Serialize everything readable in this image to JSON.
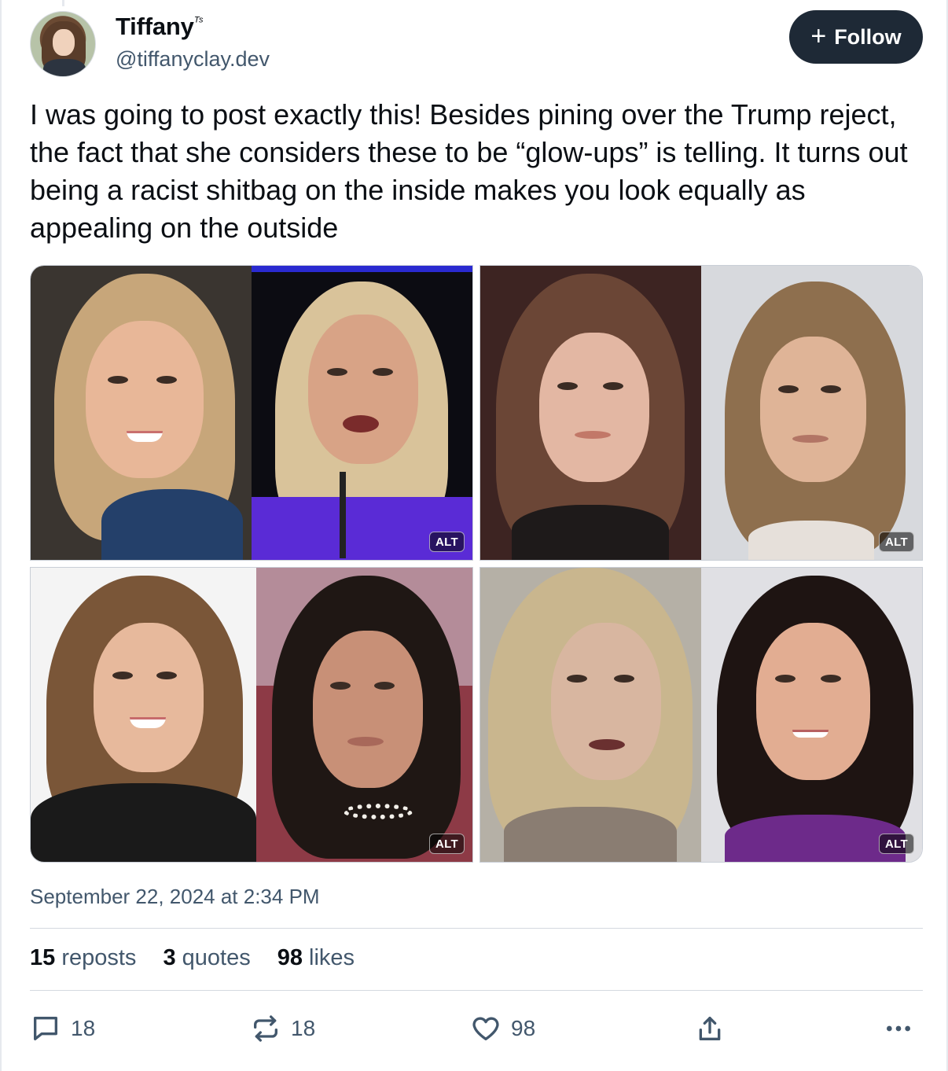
{
  "author": {
    "display_name": "Tiffany",
    "name_suffix": "ᵀˢ",
    "handle": "@tiffanyclay.dev"
  },
  "follow_button": {
    "label": "Follow",
    "icon": "plus-icon"
  },
  "post": {
    "text": "I was going to post exactly this! Besides pining over the Trump reject, the fact that she considers these to be “glow-ups” is telling. It turns out being a racist shitbag on the inside makes you look equally as appealing on the outside",
    "images": [
      {
        "alt_label": "ALT"
      },
      {
        "alt_label": "ALT"
      },
      {
        "alt_label": "ALT"
      },
      {
        "alt_label": "ALT"
      }
    ],
    "timestamp": "September 22, 2024 at 2:34 PM"
  },
  "stats": {
    "reposts_count": "15",
    "reposts_label": "reposts",
    "quotes_count": "3",
    "quotes_label": "quotes",
    "likes_count": "98",
    "likes_label": "likes"
  },
  "actions": {
    "reply_count": "18",
    "repost_count": "18",
    "like_count": "98",
    "share_icon": "share-icon",
    "more_icon": "more-icon"
  },
  "colors": {
    "follow_bg": "#1e2936",
    "muted_text": "#42576c",
    "divider": "#d4d9e0"
  }
}
